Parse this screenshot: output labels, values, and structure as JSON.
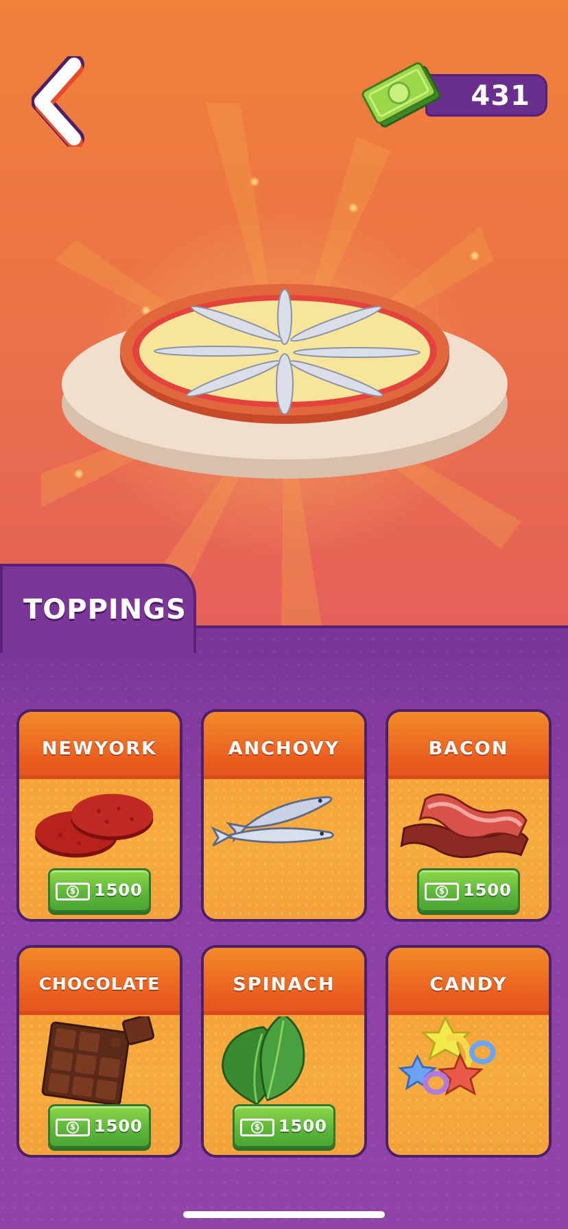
{
  "header": {
    "back_icon": "chevron-left-icon",
    "currency_icon": "cash-stack-icon",
    "currency_value": "431"
  },
  "preview": {
    "item": "pizza-anchovy"
  },
  "panel": {
    "tab_label": "TOPPINGS"
  },
  "toppings": [
    {
      "name": "NEWYORK",
      "art": "pepperoni-icon",
      "price": "1500",
      "has_price": true
    },
    {
      "name": "ANCHOVY",
      "art": "anchovy-icon",
      "price": "",
      "has_price": false
    },
    {
      "name": "BACON",
      "art": "bacon-icon",
      "price": "1500",
      "has_price": true
    },
    {
      "name": "CHOCOLATE",
      "art": "chocolate-icon",
      "price": "1500",
      "has_price": true
    },
    {
      "name": "SPINACH",
      "art": "spinach-icon",
      "price": "1500",
      "has_price": true
    },
    {
      "name": "CANDY",
      "art": "candy-icon",
      "price": "",
      "has_price": false
    }
  ],
  "colors": {
    "background_top": "#ef813a",
    "panel": "#7a3597",
    "card_orange": "#f49a31",
    "price_green": "#5fb83a",
    "currency_pill": "#6a2f8e"
  }
}
